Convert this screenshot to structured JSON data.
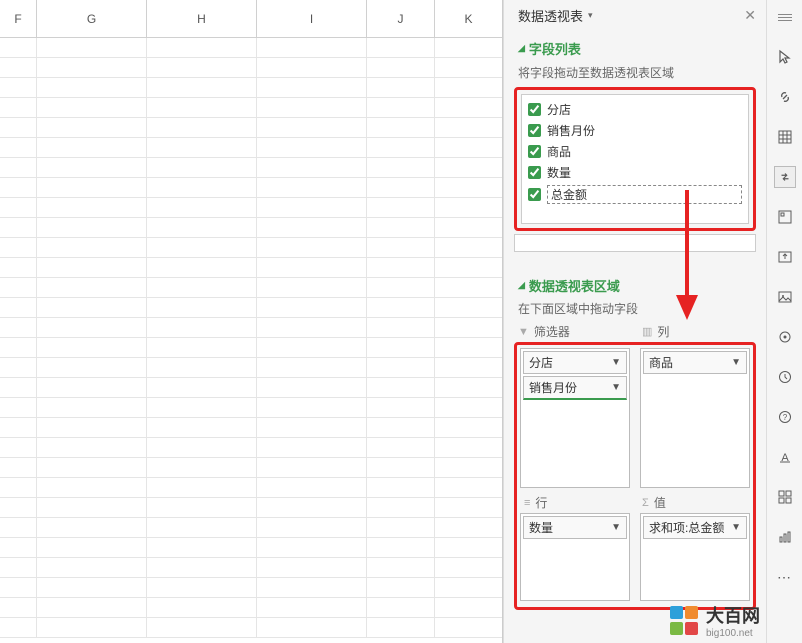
{
  "spreadsheet": {
    "columns": [
      "F",
      "G",
      "H",
      "I",
      "J",
      "K"
    ]
  },
  "panel": {
    "title": "数据透视表",
    "fieldsSection": {
      "title": "字段列表",
      "hint": "将字段拖动至数据透视表区域",
      "fields": [
        {
          "label": "分店",
          "checked": true
        },
        {
          "label": "销售月份",
          "checked": true
        },
        {
          "label": "商品",
          "checked": true
        },
        {
          "label": "数量",
          "checked": true
        },
        {
          "label": "总金额",
          "checked": true
        }
      ]
    },
    "areasSection": {
      "title": "数据透视表区域",
      "hint": "在下面区域中拖动字段",
      "filterLabel": "筛选器",
      "columnLabel": "列",
      "rowLabel": "行",
      "valueLabel": "值",
      "filterItems": [
        "分店",
        "销售月份"
      ],
      "columnItems": [
        "商品"
      ],
      "rowItems": [
        "数量"
      ],
      "valueItems": [
        "求和项:总金额"
      ]
    }
  },
  "watermark": {
    "name": "大百网",
    "url": "big100.net"
  }
}
